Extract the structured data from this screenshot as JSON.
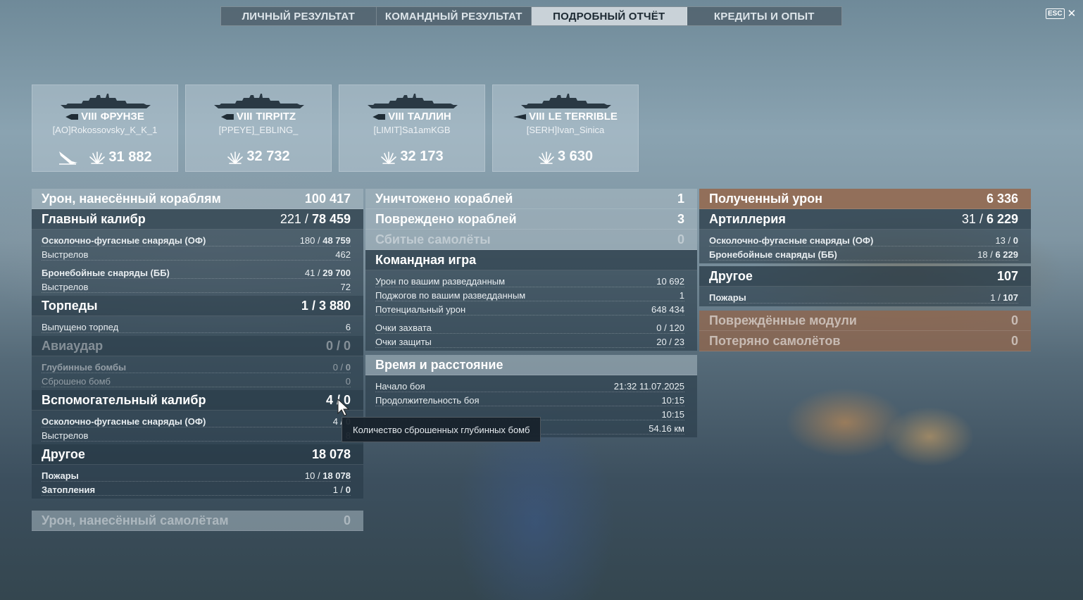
{
  "tabs": [
    {
      "label": "ЛИЧНЫЙ РЕЗУЛЬТАТ"
    },
    {
      "label": "КОМАНДНЫЙ РЕЗУЛЬТАТ"
    },
    {
      "label": "ПОДРОБНЫЙ ОТЧЁТ"
    },
    {
      "label": "КРЕДИТЫ И ОПЫТ"
    }
  ],
  "active_tab": 2,
  "esc": {
    "key": "ESC",
    "close": "✕"
  },
  "cards": [
    {
      "tier": "VIII",
      "ship": "ФРУНЗЕ",
      "player": "[AO]Rokossovsky_K_K_1",
      "damage": "31 882",
      "icon": "torpedo-hit-icon",
      "class_icon": "cruiser-class-icon"
    },
    {
      "tier": "VIII",
      "ship": "TIRPITZ",
      "player": "[PPEYE]_EBLING_",
      "damage": "32 732",
      "class_icon": "battleship-class-icon"
    },
    {
      "tier": "VIII",
      "ship": "ТАЛЛИН",
      "player": "[LIMIT]Sa1amKGB",
      "damage": "32 173",
      "class_icon": "cruiser-class-icon"
    },
    {
      "tier": "VIII",
      "ship": "LE TERRIBLE",
      "player": "[SERH]Ivan_Sinica",
      "damage": "3 630",
      "class_icon": "destroyer-class-icon"
    }
  ],
  "left": {
    "damage_ships": {
      "label": "Урон, нанесённый кораблям",
      "value": "100 417"
    },
    "main_battery": {
      "label": "Главный калибр",
      "hits": "221",
      "damage": "78 459"
    },
    "he_shells": {
      "label": "Осколочно-фугасные снаряды (ОФ)",
      "hits": "180",
      "damage": "48 759"
    },
    "he_shots": {
      "label": "Выстрелов",
      "value": "462"
    },
    "ap_shells": {
      "label": "Бронебойные снаряды (ББ)",
      "hits": "41",
      "damage": "29 700"
    },
    "ap_shots": {
      "label": "Выстрелов",
      "value": "72"
    },
    "torpedoes": {
      "label": "Торпеды",
      "hits": "1",
      "damage": "3 880"
    },
    "torps_fired": {
      "label": "Выпущено торпед",
      "value": "6"
    },
    "airstrike": {
      "label": "Авиаудар",
      "hits": "0",
      "damage": "0"
    },
    "depth_charges": {
      "label": "Глубинные бомбы",
      "hits": "0",
      "damage": "0"
    },
    "bombs_dropped": {
      "label": "Сброшено бомб",
      "value": "0"
    },
    "secondary": {
      "label": "Вспомогательный калибр",
      "hits": "4",
      "damage": "0"
    },
    "sec_he": {
      "label": "Осколочно-фугасные снаряды (ОФ)",
      "hits": "4",
      "damage": "0"
    },
    "sec_shots": {
      "label": "Выстрелов",
      "value": "8"
    },
    "other": {
      "label": "Другое",
      "value": "18 078"
    },
    "fires": {
      "label": "Пожары",
      "hits": "10",
      "damage": "18 078"
    },
    "floods": {
      "label": "Затопления",
      "hits": "1",
      "damage": "0"
    },
    "damage_planes": {
      "label": "Урон, нанесённый самолётам",
      "value": "0"
    }
  },
  "middle": {
    "destroyed": {
      "label": "Уничтожено кораблей",
      "value": "1"
    },
    "damaged": {
      "label": "Повреждено кораблей",
      "value": "3"
    },
    "planes_shot": {
      "label": "Сбитые самолёты",
      "value": "0"
    },
    "team_play": {
      "label": "Командная игра"
    },
    "spot_damage": {
      "label": "Урон по вашим разведданным",
      "value": "10 692"
    },
    "spot_fires": {
      "label": "Поджогов по вашим разведданным",
      "value": "1"
    },
    "potential": {
      "label": "Потенциальный урон",
      "value": "648 434"
    },
    "capture": {
      "label": "Очки захвата",
      "value": "0 / 120"
    },
    "defense": {
      "label": "Очки защиты",
      "value": "20 / 23"
    },
    "time_distance": {
      "label": "Время и расстояние"
    },
    "start": {
      "label": "Начало боя",
      "value": "21:32  11.07.2025"
    },
    "duration": {
      "label": "Продолжительность боя",
      "value": "10:15"
    },
    "survived": {
      "value": "10:15"
    },
    "distance": {
      "value": "54.16 км"
    }
  },
  "right": {
    "received": {
      "label": "Полученный урон",
      "value": "6 336"
    },
    "artillery": {
      "label": "Артиллерия",
      "hits": "31",
      "damage": "6 229"
    },
    "he": {
      "label": "Осколочно-фугасные снаряды (ОФ)",
      "hits": "13",
      "damage": "0"
    },
    "ap": {
      "label": "Бронебойные снаряды (ББ)",
      "hits": "18",
      "damage": "6 229"
    },
    "other": {
      "label": "Другое",
      "value": "107"
    },
    "fires": {
      "label": "Пожары",
      "hits": "1",
      "damage": "107"
    },
    "modules": {
      "label": "Повреждённые модули",
      "value": "0"
    },
    "planes_lost": {
      "label": "Потеряно самолётов",
      "value": "0"
    }
  },
  "tooltip": {
    "text": "Количество сброшенных глубинных бомб"
  },
  "sep": " / "
}
